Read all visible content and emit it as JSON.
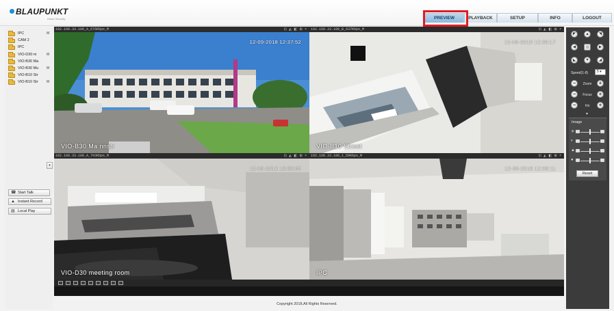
{
  "brand": {
    "name": "BLAUPUNKT",
    "tagline": "Home Security"
  },
  "nav": {
    "tabs": [
      {
        "label": "PREVIEW",
        "active": true
      },
      {
        "label": "PLAYBACK",
        "active": false
      },
      {
        "label": "SETUP",
        "active": false
      },
      {
        "label": "INFO",
        "active": false
      },
      {
        "label": "LOGOUT",
        "active": false
      }
    ],
    "highlight_color": "#e01c24"
  },
  "devices": [
    {
      "name": "IPC",
      "mark": "M"
    },
    {
      "name": "CAM 2",
      "mark": ""
    },
    {
      "name": "IPC",
      "mark": ""
    },
    {
      "name": "VIO-D30 m",
      "mark": "M"
    },
    {
      "name": "VIO-B30 Ma",
      "mark": ""
    },
    {
      "name": "VIO-B30 Mu",
      "mark": "M"
    },
    {
      "name": "VIO-B10 Str",
      "mark": ""
    },
    {
      "name": "VIO-B10 Str",
      "mark": "M"
    }
  ],
  "actions": {
    "start_talk": "Start Talk",
    "instant_record": "Instant Record",
    "local_play": "Local Play"
  },
  "panes": [
    {
      "ip": "192.168.33.180_A_676Kbps_M",
      "timestamp": "12-09-2018 12:37:52",
      "camera": "VIO-B30 Ma nnstr"
    },
    {
      "ip": "192.168.33.180_B_637Kbps_M",
      "timestamp": "12-09-2018 12:38:17",
      "camera": "VIO-B10 Street"
    },
    {
      "ip": "192.168.33.180_A_793Kbps_M",
      "timestamp": "12-09-2018 13:38:05",
      "camera": "VIO-D30 meeting room"
    },
    {
      "ip": "192.168.33.180_1_59Kbps_M",
      "timestamp": "12-09-2018 12:38:11",
      "camera": "IPC"
    }
  ],
  "pane_icons": "⊡ ◭ ◧ ⊞ ×",
  "ptz": {
    "speed_label": "Speed(1-8)",
    "speed_value": "5",
    "zoom_label": "Zoom",
    "focus_label": "Focus",
    "iris_label": "Iris"
  },
  "image": {
    "title": "Image",
    "sliders": [
      {
        "icon": "brightness-icon",
        "glyph": "☀",
        "level": 0.5
      },
      {
        "icon": "contrast-icon",
        "glyph": "◐",
        "level": 0.5
      },
      {
        "icon": "saturation-icon",
        "glyph": "▲",
        "level": 0.5
      },
      {
        "icon": "hue-icon",
        "glyph": "●",
        "level": 0.5
      }
    ],
    "reset_label": "Reset"
  },
  "footer": {
    "copyright": "Copyright 2018,All Rights Reserved."
  }
}
